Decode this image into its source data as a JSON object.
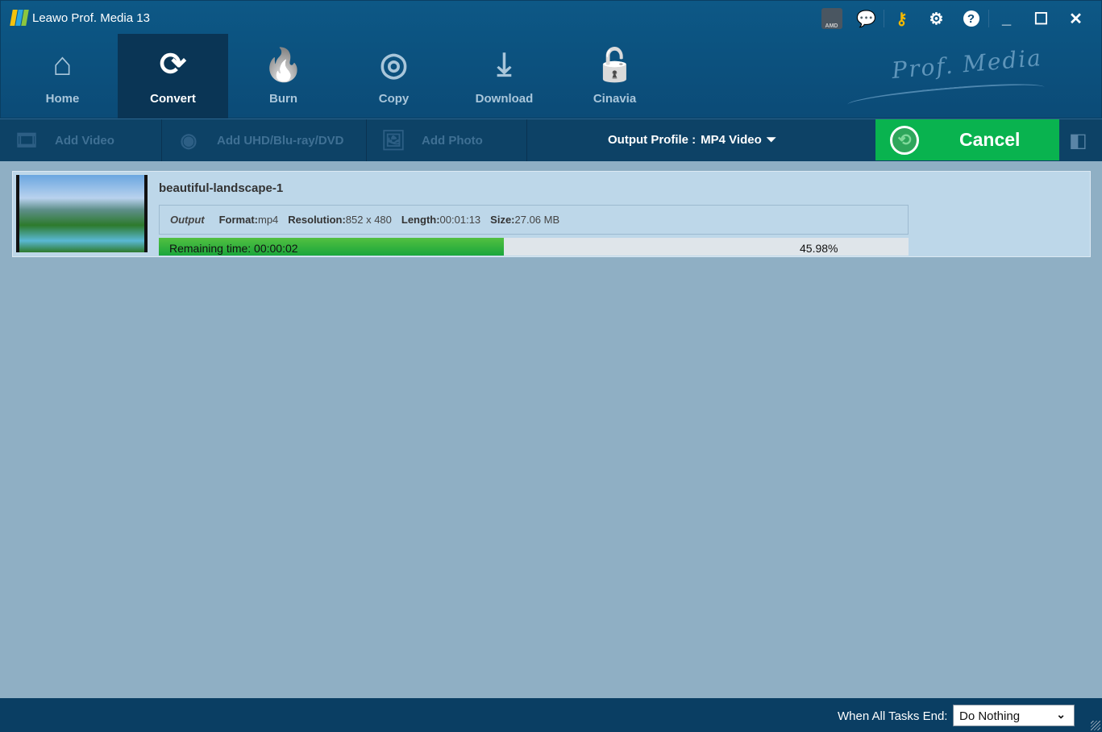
{
  "app": {
    "title": "Leawo Prof. Media 13",
    "logo_text": "Prof. Media"
  },
  "window_controls": {
    "minimize": "_",
    "maximize": "☐",
    "close": "✕"
  },
  "top_icons": [
    "amd-badge-icon",
    "feedback-icon",
    "register-key-icon",
    "settings-icon",
    "help-icon"
  ],
  "nav": [
    {
      "label": "Home",
      "icon": "⌂"
    },
    {
      "label": "Convert",
      "icon": "⟳",
      "active": true
    },
    {
      "label": "Burn",
      "icon": "🔥"
    },
    {
      "label": "Copy",
      "icon": "◎"
    },
    {
      "label": "Download",
      "icon": "⤓"
    },
    {
      "label": "Cinavia",
      "icon": "🔓"
    }
  ],
  "toolbar": {
    "add_video": "Add Video",
    "add_disc": "Add UHD/Blu-ray/DVD",
    "add_photo": "Add Photo",
    "output_profile_label": "Output Profile :",
    "output_profile_value": "MP4 Video",
    "cancel": "Cancel"
  },
  "task": {
    "name": "beautiful-landscape-1",
    "output_label": "Output",
    "format_label": "Format:",
    "format": "mp4",
    "resolution_label": "Resolution:",
    "resolution": "852 x 480",
    "length_label": "Length:",
    "length": "00:01:13",
    "size_label": "Size:",
    "size": "27.06 MB",
    "remaining": "Remaining time: 00:00:02",
    "progress_text": "45.98%",
    "progress": 45.98
  },
  "footer": {
    "label": "When All Tasks End:",
    "value": "Do Nothing"
  },
  "colors": {
    "accent_green": "#09b34f",
    "header": "#0b4b77"
  }
}
